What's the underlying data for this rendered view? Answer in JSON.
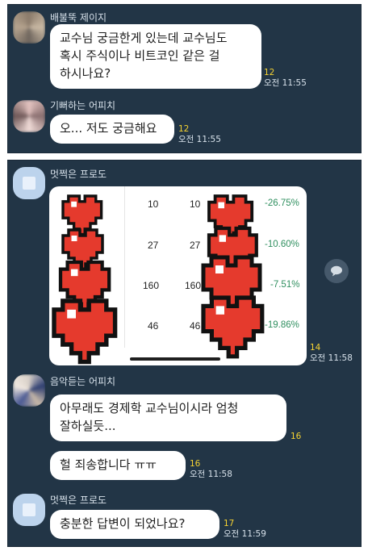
{
  "panel1": {
    "messages": [
      {
        "sender": "배불뚝 제이지",
        "text": "교수님 궁금한게 있는데 교수님도\n혹시 주식이나 비트코인 같은 걸\n하시나요?",
        "count": "12",
        "time": "오전 11:55"
      },
      {
        "sender": "기뻐하는 어피치",
        "text": "오... 저도 궁금해요",
        "count": "12",
        "time": "오전 11:55"
      }
    ]
  },
  "panel2": {
    "image_message": {
      "sender": "멋쩍은 프로도",
      "count": "14",
      "time": "오전 11:58",
      "left_numbers": [
        "10",
        "27",
        "160",
        "46"
      ],
      "right_numbers": [
        "10",
        "27",
        "160",
        "46"
      ],
      "percents": [
        "-26.75%",
        "-10.60%",
        "-7.51%",
        "-19.86%"
      ],
      "percent_color": "#2f8f5f"
    },
    "messages": [
      {
        "sender": "음악듣는 어피치",
        "text": "아무래도 경제학 교수님이시라 엄청\n잘하실듯...",
        "count": "16",
        "time": ""
      },
      {
        "text": "헐 죄송합니다 ㅠㅠ",
        "count": "16",
        "time": "오전 11:58"
      },
      {
        "sender": "멋쩍은 프로도",
        "text": "충분한 답변이 되었나요?",
        "count": "17",
        "time": "오전 11:59"
      }
    ]
  },
  "icons": {
    "share": "share-icon",
    "heart": "pixel-heart-icon"
  },
  "colors": {
    "chat_bg": "#223546",
    "unread": "#f5d232",
    "heart": "#e53a2d"
  }
}
